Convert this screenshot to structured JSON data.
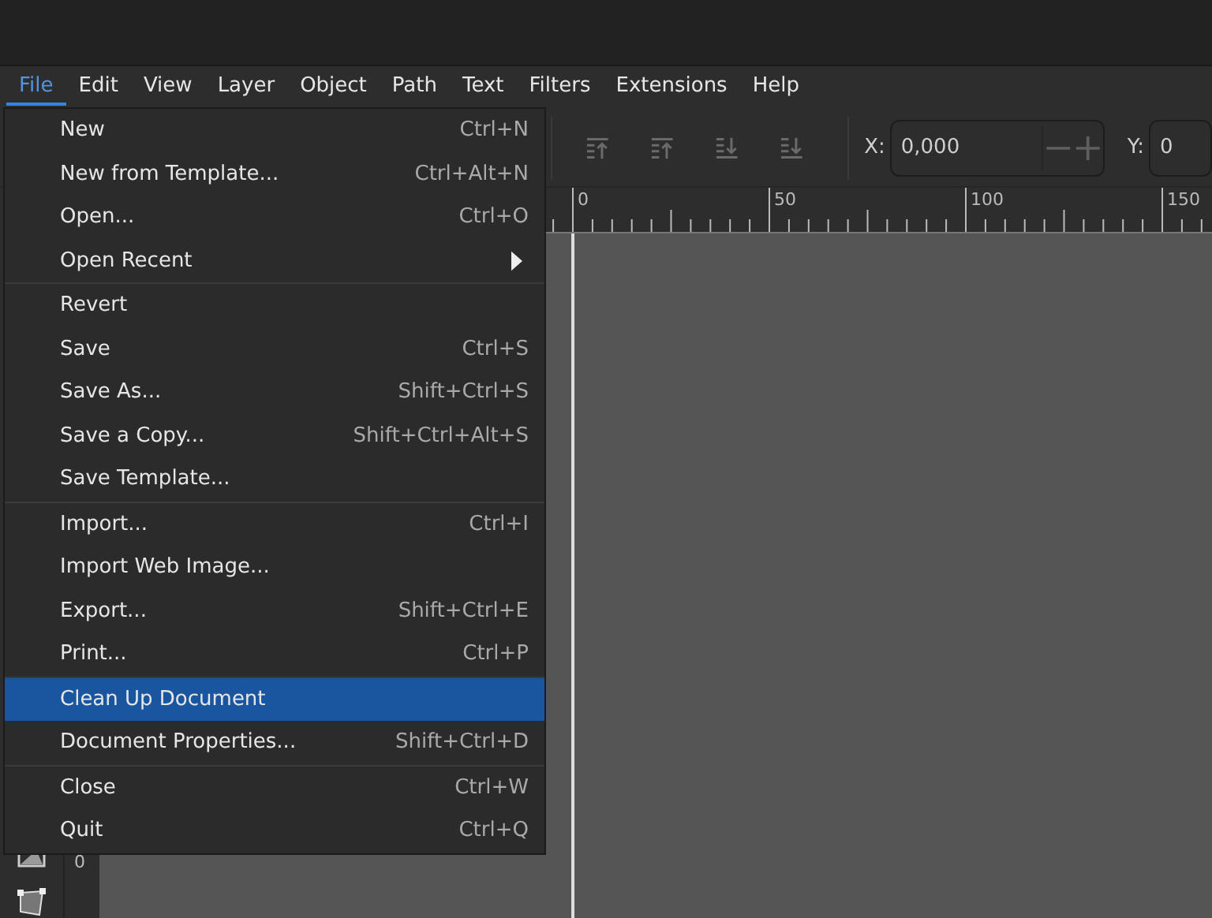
{
  "menubar": [
    {
      "label": "File",
      "selected": true
    },
    {
      "label": "Edit",
      "selected": false
    },
    {
      "label": "View",
      "selected": false
    },
    {
      "label": "Layer",
      "selected": false
    },
    {
      "label": "Object",
      "selected": false
    },
    {
      "label": "Path",
      "selected": false
    },
    {
      "label": "Text",
      "selected": false
    },
    {
      "label": "Filters",
      "selected": false
    },
    {
      "label": "Extensions",
      "selected": false
    },
    {
      "label": "Help",
      "selected": false
    }
  ],
  "file_menu": [
    [
      {
        "label": "New",
        "shortcut": "Ctrl+N",
        "submenu": false,
        "selected": false
      },
      {
        "label": "New from Template...",
        "shortcut": "Ctrl+Alt+N",
        "submenu": false,
        "selected": false
      },
      {
        "label": "Open...",
        "shortcut": "Ctrl+O",
        "submenu": false,
        "selected": false
      },
      {
        "label": "Open Recent",
        "submenu": true,
        "selected": false
      }
    ],
    [
      {
        "label": "Revert",
        "submenu": false,
        "selected": false
      },
      {
        "label": "Save",
        "shortcut": "Ctrl+S",
        "submenu": false,
        "selected": false
      },
      {
        "label": "Save As...",
        "shortcut": "Shift+Ctrl+S",
        "submenu": false,
        "selected": false
      },
      {
        "label": "Save a Copy...",
        "shortcut": "Shift+Ctrl+Alt+S",
        "submenu": false,
        "selected": false
      },
      {
        "label": "Save Template...",
        "submenu": false,
        "selected": false
      }
    ],
    [
      {
        "label": "Import...",
        "shortcut": "Ctrl+I",
        "submenu": false,
        "selected": false
      },
      {
        "label": "Import Web Image...",
        "submenu": false,
        "selected": false
      },
      {
        "label": "Export...",
        "shortcut": "Shift+Ctrl+E",
        "submenu": false,
        "selected": false
      },
      {
        "label": "Print...",
        "shortcut": "Ctrl+P",
        "submenu": false,
        "selected": false
      }
    ],
    [
      {
        "label": "Clean Up Document",
        "submenu": false,
        "selected": true
      },
      {
        "label": "Document Properties...",
        "shortcut": "Shift+Ctrl+D",
        "submenu": false,
        "selected": false
      }
    ],
    [
      {
        "label": "Close",
        "shortcut": "Ctrl+W",
        "submenu": false,
        "selected": false
      },
      {
        "label": "Quit",
        "shortcut": "Ctrl+Q",
        "submenu": false,
        "selected": false
      }
    ]
  ],
  "toolbar": {
    "x_label": "X:",
    "x_value": "0,000",
    "y_label": "Y:",
    "y_value": "0"
  },
  "horizontal_ruler": [
    "0",
    "50",
    "100",
    "150"
  ],
  "vertical_ruler": [
    "0"
  ]
}
